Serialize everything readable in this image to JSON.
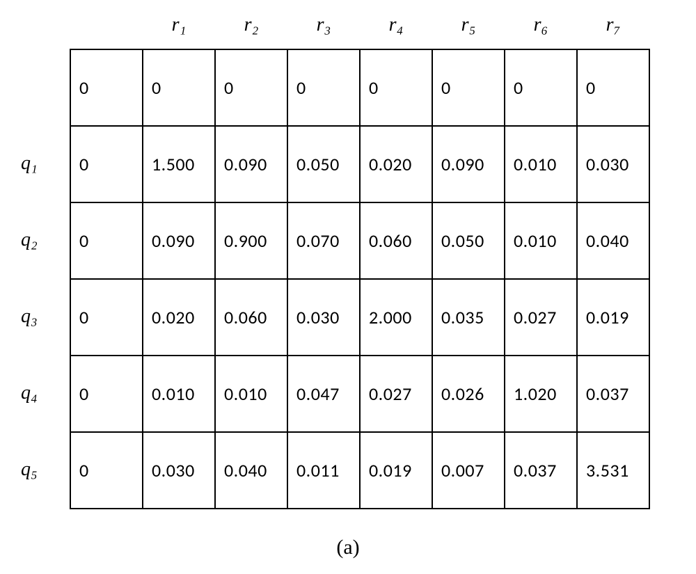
{
  "chart_data": {
    "type": "table",
    "caption": "(a)",
    "col_headers": [
      "r₁",
      "r₂",
      "r₃",
      "r₄",
      "r₅",
      "r₆",
      "r₇"
    ],
    "row_headers": [
      "q₁",
      "q₂",
      "q₃",
      "q₄",
      "q₅"
    ],
    "rows": [
      [
        "0",
        "0",
        "0",
        "0",
        "0",
        "0",
        "0",
        "0"
      ],
      [
        "0",
        "1.500",
        "0.090",
        "0.050",
        "0.020",
        "0.090",
        "0.010",
        "0.030"
      ],
      [
        "0",
        "0.090",
        "0.900",
        "0.070",
        "0.060",
        "0.050",
        "0.010",
        "0.040"
      ],
      [
        "0",
        "0.020",
        "0.060",
        "0.030",
        "2.000",
        "0.035",
        "0.027",
        "0.019"
      ],
      [
        "0",
        "0.010",
        "0.010",
        "0.047",
        "0.027",
        "0.026",
        "1.020",
        "0.037"
      ],
      [
        "0",
        "0.030",
        "0.040",
        "0.011",
        "0.019",
        "0.007",
        "0.037",
        "3.531"
      ]
    ]
  }
}
